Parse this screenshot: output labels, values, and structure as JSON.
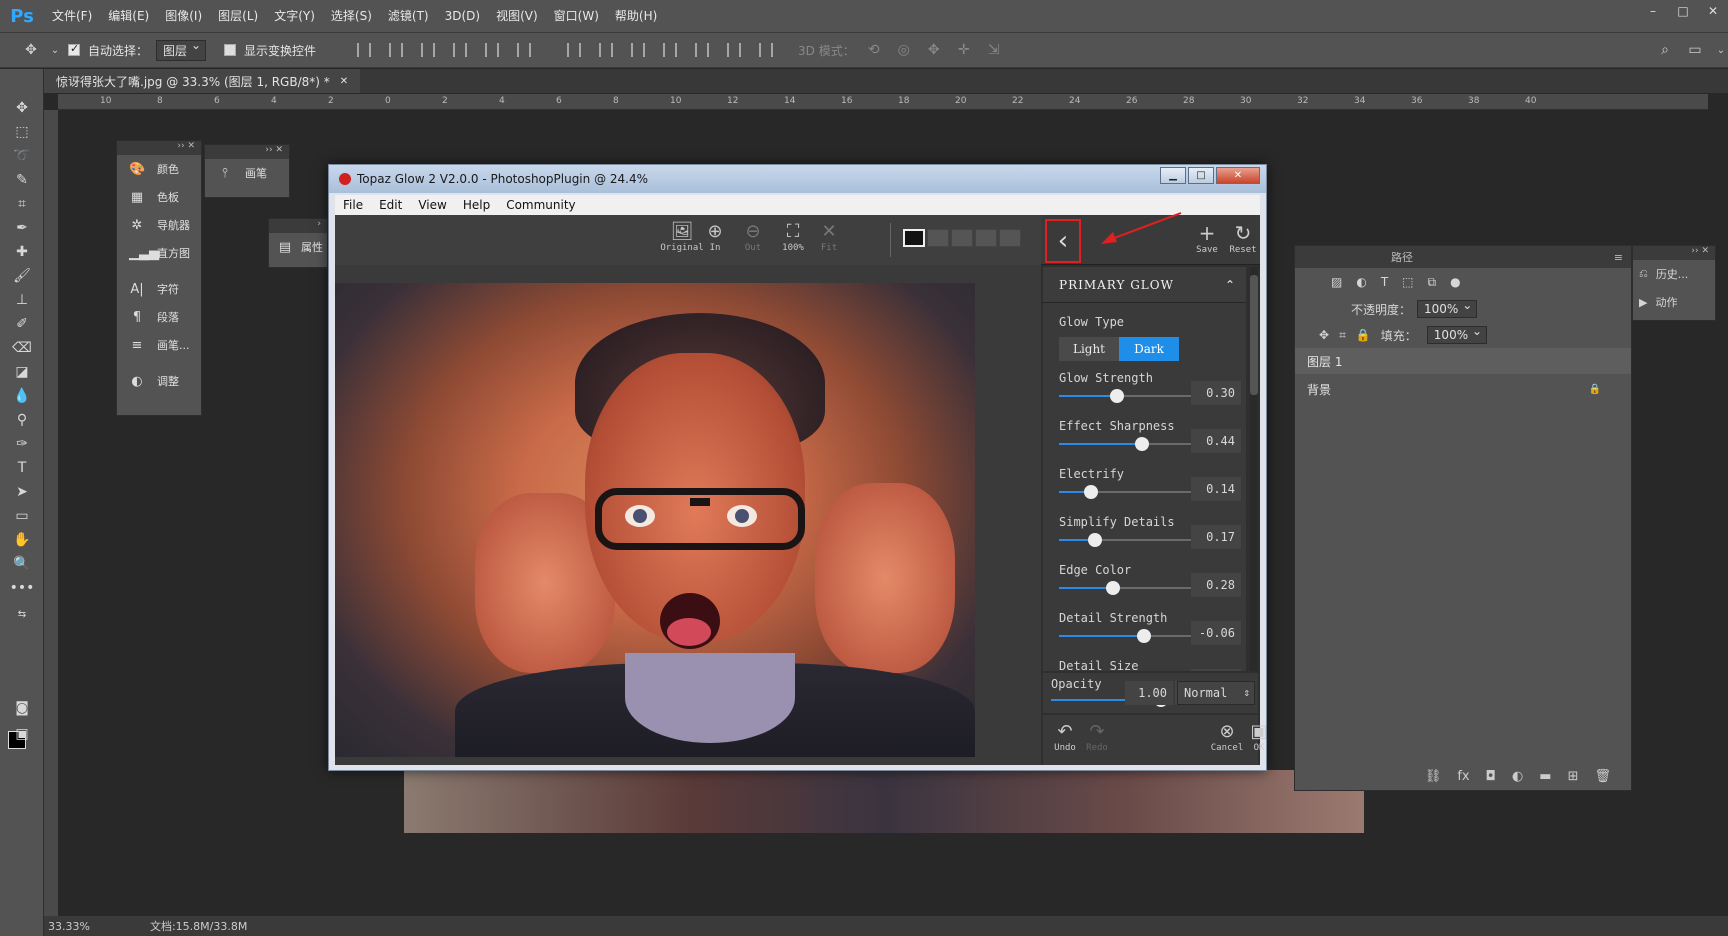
{
  "app": {
    "logo": "Ps",
    "menu": [
      "文件(F)",
      "编辑(E)",
      "图像(I)",
      "图层(L)",
      "文字(Y)",
      "选择(S)",
      "滤镜(T)",
      "3D(D)",
      "视图(V)",
      "窗口(W)",
      "帮助(H)"
    ],
    "window_controls": [
      "–",
      "□",
      "✕"
    ]
  },
  "options": {
    "auto_select_label": "自动选择：",
    "auto_select_target": "图层",
    "show_transform_label": "显示变换控件",
    "mode_3d_label": "3D 模式："
  },
  "document": {
    "tab_title": "惊讶得张大了嘴.jpg @ 33.3% (图层 1, RGB/8*) *",
    "tab_close": "✕",
    "zoom": "33.33%",
    "doc_size": "文档:15.8M/33.8M"
  },
  "ruler_ticks": [
    "10",
    "8",
    "6",
    "4",
    "2",
    "0",
    "2",
    "4",
    "6",
    "8",
    "10",
    "12",
    "14",
    "16",
    "18",
    "20",
    "22",
    "24",
    "26",
    "28",
    "30",
    "32",
    "34",
    "36",
    "38",
    "40"
  ],
  "floating_panel_1": {
    "items": [
      {
        "icon": "palette-icon",
        "glyph": "🎨",
        "label": "颜色"
      },
      {
        "icon": "swatches-icon",
        "glyph": "▦",
        "label": "色板"
      },
      {
        "icon": "navigator-icon",
        "glyph": "✲",
        "label": "导航器"
      },
      {
        "icon": "histogram-icon",
        "glyph": "▁▃▅",
        "label": "直方图"
      },
      {
        "icon": "character-icon",
        "glyph": "A|",
        "label": "字符"
      },
      {
        "icon": "paragraph-icon",
        "glyph": "¶",
        "label": "段落"
      },
      {
        "icon": "brush-settings-icon",
        "glyph": "≡",
        "label": "画笔..."
      },
      {
        "icon": "adjustments-icon",
        "glyph": "◐",
        "label": "调整"
      }
    ]
  },
  "floating_panel_2": {
    "label": "画笔"
  },
  "floating_panel_3": {
    "label": "属性"
  },
  "layers": {
    "tab_paths": "路径",
    "opacity_label": "不透明度：",
    "opacity_value": "100%",
    "fill_label": "填充：",
    "fill_value": "100%",
    "rows": [
      {
        "name": "图层 1",
        "selected": true
      },
      {
        "name": "背景",
        "selected": false,
        "locked": true
      }
    ]
  },
  "history": {
    "items": [
      {
        "icon": "history-icon",
        "label": "历史..."
      },
      {
        "icon": "play-icon",
        "label": "动作"
      }
    ]
  },
  "topaz": {
    "title": "Topaz Glow 2 V2.0.0 - PhotoshopPlugin @ 24.4%",
    "menu": [
      "File",
      "Edit",
      "View",
      "Help",
      "Community"
    ],
    "view_buttons": [
      {
        "icon": "image-icon",
        "glyph": "🖼",
        "label": "Original",
        "dim": false
      },
      {
        "icon": "zoom-in-icon",
        "glyph": "⊕",
        "label": "In",
        "dim": false
      },
      {
        "icon": "zoom-out-icon",
        "glyph": "⊖",
        "label": "Out",
        "dim": true
      },
      {
        "icon": "fit-100-icon",
        "glyph": "⛶",
        "label": "100%",
        "dim": false
      },
      {
        "icon": "fit-icon",
        "glyph": "✕",
        "label": "Fit",
        "dim": true
      }
    ],
    "side_buttons": [
      {
        "icon": "plus-icon",
        "glyph": "+",
        "label": "Save"
      },
      {
        "icon": "reset-icon",
        "glyph": "↻",
        "label": "Reset"
      }
    ],
    "section_title": "PRIMARY GLOW",
    "glow_type_label": "Glow Type",
    "glow_type_options": [
      "Light",
      "Dark"
    ],
    "glow_type_selected": "Dark",
    "sliders": [
      {
        "label": "Glow Strength",
        "value": "0.30",
        "fraction": 0.32
      },
      {
        "label": "Effect Sharpness",
        "value": "0.44",
        "fraction": 0.46
      },
      {
        "label": "Electrify",
        "value": "0.14",
        "fraction": 0.18
      },
      {
        "label": "Simplify Details",
        "value": "0.17",
        "fraction": 0.2
      },
      {
        "label": "Edge Color",
        "value": "0.28",
        "fraction": 0.3
      },
      {
        "label": "Detail Strength",
        "value": "-0.06",
        "fraction": 0.47
      },
      {
        "label": "Detail Size",
        "value": "",
        "fraction": 0.5
      }
    ],
    "opacity": {
      "label": "Opacity",
      "value": "1.00",
      "fraction": 1.0
    },
    "blend_mode": "Normal",
    "bottom_buttons": [
      {
        "icon": "undo-icon",
        "glyph": "↶",
        "label": "Undo",
        "dim": false
      },
      {
        "icon": "redo-icon",
        "glyph": "↷",
        "label": "Redo",
        "dim": true
      },
      {
        "icon": "cancel-icon",
        "glyph": "⊗",
        "label": "Cancel",
        "dim": false
      },
      {
        "icon": "ok-save-icon",
        "glyph": "▣",
        "label": "OK",
        "dim": false
      }
    ]
  },
  "colors": {
    "accent": "#1e8ee8",
    "annotation": "#e02020"
  }
}
